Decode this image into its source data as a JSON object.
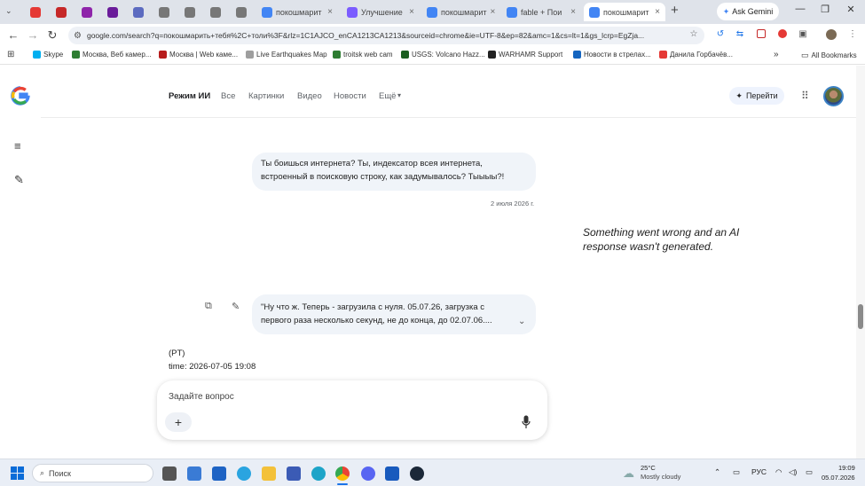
{
  "browser": {
    "tabs": [
      {
        "title": "",
        "color": "#e53935"
      },
      {
        "title": "",
        "color": "#c62828"
      },
      {
        "title": "",
        "color": "#8e24aa"
      },
      {
        "title": "",
        "color": "#6a1b9a"
      },
      {
        "title": "",
        "color": "#5c6bc0"
      },
      {
        "title": "",
        "color": "#777777"
      },
      {
        "title": "",
        "color": "#777777"
      },
      {
        "title": "",
        "color": "#777777"
      },
      {
        "title": "",
        "color": "#777777"
      },
      {
        "title": "покошмарит",
        "color": "#4285f4"
      },
      {
        "title": "Улучшение",
        "color": "#7b5cff"
      },
      {
        "title": "покошмарит",
        "color": "#4285f4"
      },
      {
        "title": "fable + Пои",
        "color": "#4285f4"
      },
      {
        "title": "покошмарит",
        "color": "#4285f4"
      }
    ],
    "new_tab": "+",
    "gemini_label": "Ask Gemini",
    "url": "google.com/search?q=покошмарить+тебя%2C+толи%3F&rlz=1C1AJCO_enCA1213CA1213&sourceid=chrome&ie=UTF-8&ep=82&amc=1&cs=lt=1&gs_lcrp=EgZja...",
    "bookmarks": [
      {
        "label": "Skype",
        "color": "#00aff0"
      },
      {
        "label": "Москва, Веб камер...",
        "color": "#2e7d32"
      },
      {
        "label": "Москва | Web каме...",
        "color": "#b71c1c"
      },
      {
        "label": "Live Earthquakes Map",
        "color": "#9e9e9e"
      },
      {
        "label": "troitsk web cam",
        "color": "#2e7d32"
      },
      {
        "label": "USGS: Volcano Hazz...",
        "color": "#1b5e20"
      },
      {
        "label": "WARHAMR Support",
        "color": "#222222"
      },
      {
        "label": "Новости в стрелах...",
        "color": "#1565c0"
      },
      {
        "label": "Данила Горбачёв...",
        "color": "#e53935"
      }
    ],
    "all_bookmarks": "All Bookmarks"
  },
  "search_header": {
    "tabs": [
      "Режим ИИ",
      "Все",
      "Картинки",
      "Видео",
      "Новости",
      "Ещё"
    ],
    "goto_label": "Перейти"
  },
  "conversation": {
    "q1": "Ты боишься интернета? Ты, индексатор всея интернета, встроенный в поисковую строку, как задумывалось? Тыыыы?!",
    "q1_date": "2 июля 2026 г.",
    "error": "Something went wrong and an AI response wasn't generated.",
    "q2": "\"Ну что ж. Теперь - загрузила с нуля. 05.07.26, загрузка с первого раза несколько секунд, не до конца, до 02.07.06....",
    "meta_line1": "(PT)",
    "meta_line2": "time: 2026-07-05 19:08"
  },
  "ask": {
    "placeholder": "Задайте вопрос",
    "plus": "+"
  },
  "taskbar": {
    "search": "Поиск",
    "weather_temp": "25°C",
    "weather_desc": "Mostly cloudy",
    "lang": "РУС",
    "time": "19:09",
    "date": "05.07.2026"
  }
}
